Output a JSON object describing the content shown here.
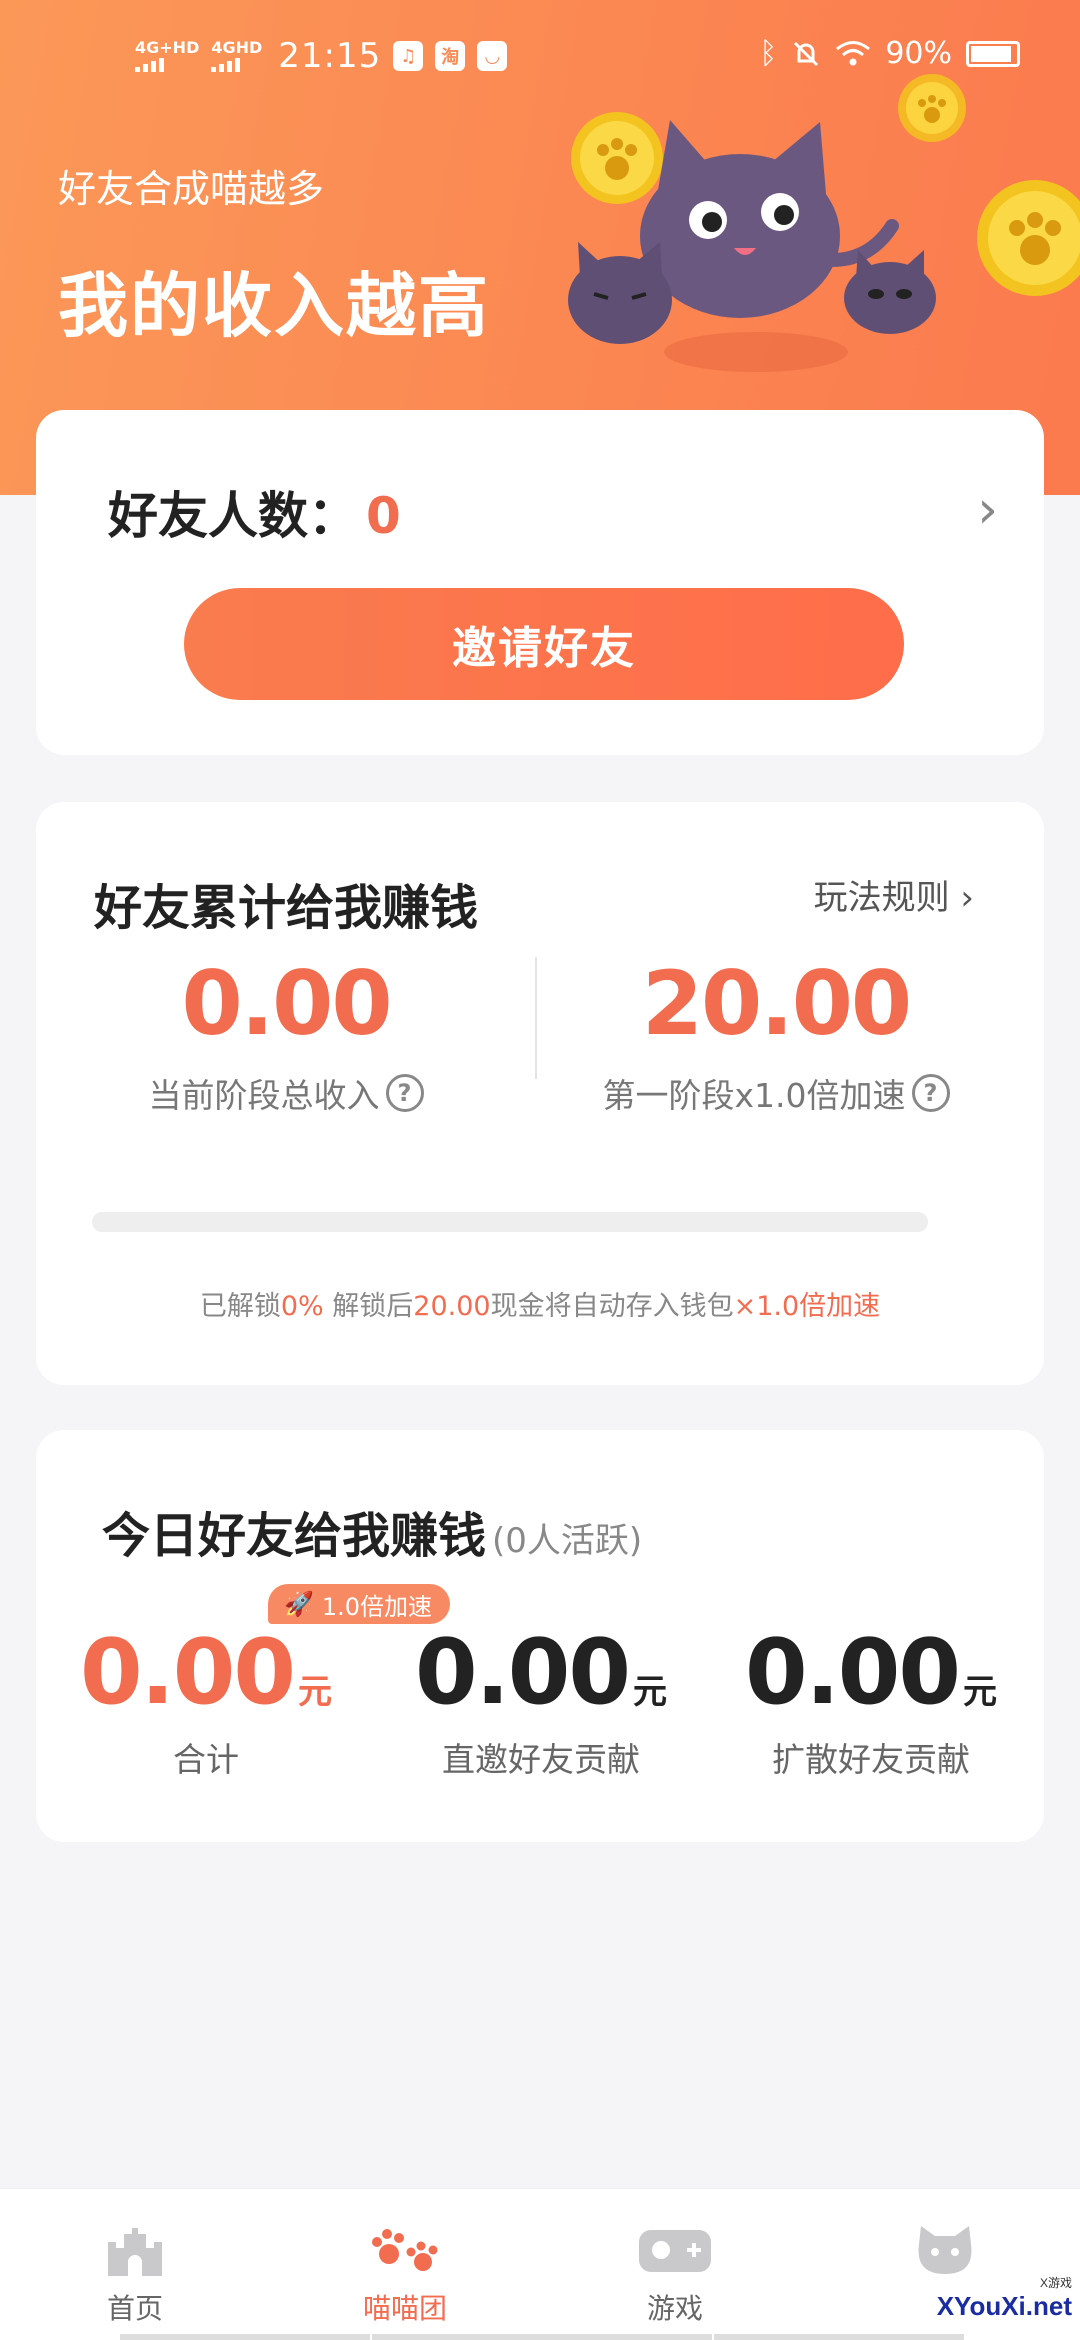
{
  "status_bar": {
    "network1": "4G+HD",
    "network2": "4GHD",
    "time": "21:15",
    "battery": "90%",
    "app_icons": [
      "music-icon",
      "taobao-icon",
      "shield-app-icon"
    ]
  },
  "hero": {
    "subtitle": "好友合成喵越多",
    "title": "我的收入越高"
  },
  "friends": {
    "label": "好友人数：",
    "count": "0",
    "invite_button": "邀请好友"
  },
  "cumulative": {
    "title": "好友累计给我赚钱",
    "rules_link": "玩法规则",
    "current_income": "0.00",
    "current_income_label": "当前阶段总收入",
    "stage_target": "20.00",
    "stage_target_label": "第一阶段x1.0倍加速",
    "progress_fraction": 0,
    "unlock_prefix": "已解锁",
    "unlock_percent": "0%",
    "unlock_mid": " 解锁后",
    "unlock_amount": "20.00",
    "unlock_suffix": "现金将自动存入钱包",
    "unlock_boost": "×1.0倍加速"
  },
  "today": {
    "title": "今日好友给我赚钱",
    "active_note": "(0人活跃)",
    "boost_badge": "1.0倍加速",
    "total_value": "0.00",
    "total_unit": "元",
    "total_label": "合计",
    "direct_value": "0.00",
    "direct_unit": "元",
    "direct_label": "直邀好友贡献",
    "spread_value": "0.00",
    "spread_unit": "元",
    "spread_label": "扩散好友贡献"
  },
  "tabs": [
    {
      "label": "首页",
      "icon": "castle-icon"
    },
    {
      "label": "喵喵团",
      "icon": "paw-icon"
    },
    {
      "label": "游戏",
      "icon": "gamepad-icon"
    },
    {
      "label": "",
      "icon": "cat-face-icon"
    }
  ],
  "watermark": {
    "brand": "XYouXi.net",
    "small": "X游戏"
  },
  "colors": {
    "accent": "#f26c4f",
    "hero": "#fb8752"
  }
}
